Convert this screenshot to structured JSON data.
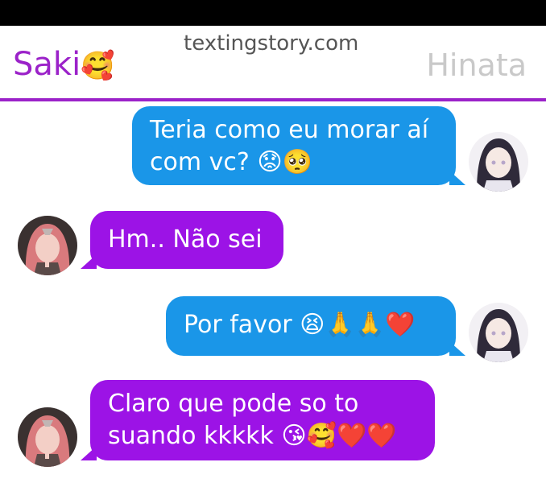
{
  "header": {
    "left_name": "Saki",
    "left_emoji": "🥰",
    "right_name": "Hinata",
    "watermark": "textingstory.com"
  },
  "colors": {
    "divider": "#9b22c9",
    "left_name": "#9b22c9",
    "right_name": "#c9c9c9",
    "bubble_right": "#1a96e8",
    "bubble_left": "#9c13e6"
  },
  "messages": [
    {
      "side": "right",
      "sender": "Hinata",
      "lines": [
        "Teria como eu morar aí",
        "com vc? 😟🥺"
      ]
    },
    {
      "side": "left",
      "sender": "Saki",
      "lines": [
        "Hm.. Não sei"
      ]
    },
    {
      "side": "right",
      "sender": "Hinata",
      "lines": [
        "Por favor 😫🙏🙏❤️"
      ]
    },
    {
      "side": "left",
      "sender": "Saki",
      "lines": [
        "Claro que pode so to",
        "suando kkkkk 😘🥰❤️❤️"
      ]
    }
  ]
}
